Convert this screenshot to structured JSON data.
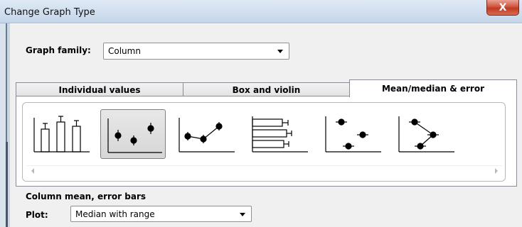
{
  "window": {
    "title": "Change Graph Type",
    "close_glyph": "X"
  },
  "graph_family": {
    "label": "Graph family:",
    "value": "Column"
  },
  "tabs": [
    {
      "label": "Individual values",
      "selected": false
    },
    {
      "label": "Box and violin",
      "selected": false
    },
    {
      "label": "Mean/median & error",
      "selected": true
    }
  ],
  "gallery": {
    "thumbnails": [
      {
        "icon": "column-bars-error-icon",
        "selected": false
      },
      {
        "icon": "scatter-mean-points-icon",
        "selected": true
      },
      {
        "icon": "connected-points-line-icon",
        "selected": false
      },
      {
        "icon": "horizontal-bars-error-icon",
        "selected": false
      },
      {
        "icon": "horizontal-points-icon",
        "selected": false
      },
      {
        "icon": "horizontal-points-connected-icon",
        "selected": false
      }
    ]
  },
  "section": {
    "title": "Column mean, error bars"
  },
  "plot": {
    "label": "Plot:",
    "value": "Median with range"
  },
  "colors": {
    "titlebar": "#c5d6ea",
    "close": "#c23a22",
    "client_bg": "#f0f0f0"
  }
}
